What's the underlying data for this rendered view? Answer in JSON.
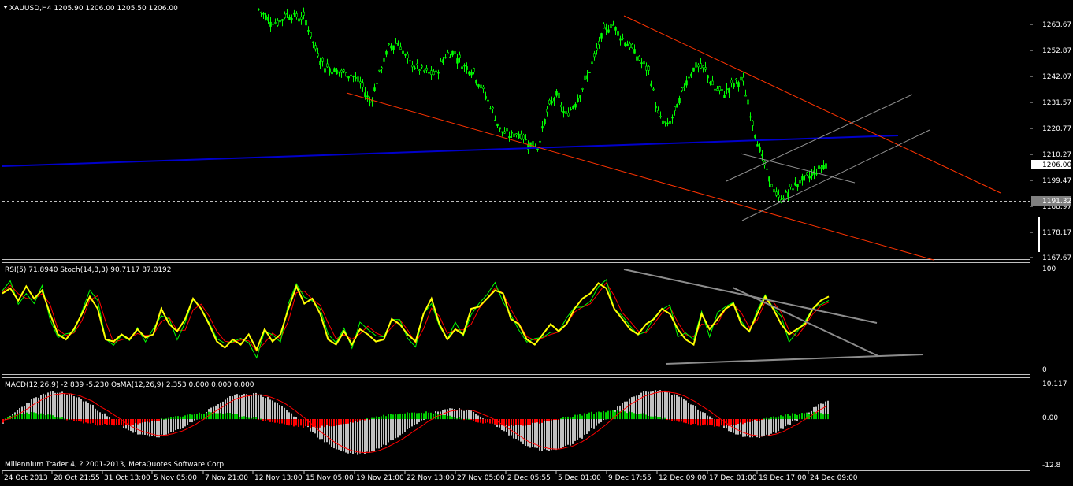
{
  "window": {
    "symbol_header": "XAUUSD,H4  1205.90 1206.00 1205.50 1206.00",
    "copyright": "Millennium Trader 4, ? 2001-2013, MetaQuotes Software Corp."
  },
  "colors": {
    "background": "#000000",
    "frame": "#c0c0c0",
    "bull_candle": "#00ff00",
    "bear_candle": "#00ff00",
    "red_channel": "#ff3300",
    "blue_trendline": "#0000cc",
    "gray_channel": "#909090",
    "rsi_line": "#ffff00",
    "stoch_main": "#00ff00",
    "stoch_signal": "#ff0000",
    "macd_pos": "#00cc00",
    "macd_neg": "#ff0000",
    "macd_hist": "#c0c0c0",
    "macd_signal": "#ff0000"
  },
  "chart_data": [
    {
      "type": "candlestick",
      "symbol": "XAUUSD",
      "timeframe": "H4",
      "ohlc_last": {
        "open": 1205.9,
        "high": 1206.0,
        "low": 1205.5,
        "close": 1206.0
      },
      "ylim": [
        1165,
        1275
      ],
      "y_ticks": [
        "1263.67",
        "1252.87",
        "1242.07",
        "1231.57",
        "1220.77",
        "1210.27",
        "1199.47",
        "1188.97",
        "1178.17",
        "1167.67"
      ],
      "current_price_label": "1206.00",
      "dashed_level_label": "1191.32",
      "dashed_level": 1191.32,
      "x_labels": [
        "24 Oct 2013",
        "28 Oct 21:55",
        "31 Oct 13:00",
        "5 Nov 05:00",
        "7 Nov 21:00",
        "12 Nov 13:00",
        "15 Nov 05:00",
        "19 Nov 21:00",
        "22 Nov 13:00",
        "27 Nov 05:00",
        "2 Dec 05:55",
        "5 Dec 01:00",
        "9 Dec 17:55",
        "12 Dec 09:00",
        "17 Dec 01:00",
        "19 Dec 17:00",
        "24 Dec 09:00"
      ],
      "close_path": [
        1272,
        1268,
        1266,
        1270,
        1269,
        1268,
        1256,
        1248,
        1246,
        1245,
        1244,
        1240,
        1232,
        1245,
        1256,
        1258,
        1250,
        1247,
        1245,
        1244,
        1252,
        1254,
        1248,
        1246,
        1238,
        1230,
        1220,
        1218,
        1219,
        1215,
        1213,
        1228,
        1236,
        1226,
        1232,
        1240,
        1250,
        1262,
        1266,
        1260,
        1256,
        1250,
        1245,
        1226,
        1222,
        1230,
        1242,
        1248,
        1246,
        1238,
        1236,
        1240,
        1242,
        1225,
        1210,
        1198,
        1190,
        1194,
        1198,
        1200,
        1203,
        1206
      ],
      "close_path_range": [
        0,
        1055
      ]
    },
    {
      "type": "line",
      "title": "RSI(5) 71.8940  Stoch(14,3,3) 90.7117 87.0192",
      "ylim": [
        0,
        100
      ],
      "y_ticks": [
        "100",
        "0"
      ],
      "series": [
        {
          "name": "RSI(5)",
          "last": 71.894,
          "values": [
            75,
            80,
            68,
            82,
            70,
            78,
            55,
            35,
            30,
            40,
            55,
            72,
            60,
            30,
            28,
            35,
            30,
            40,
            32,
            35,
            60,
            45,
            38,
            50,
            70,
            60,
            45,
            28,
            22,
            30,
            25,
            35,
            20,
            40,
            28,
            35,
            60,
            82,
            65,
            70,
            55,
            30,
            25,
            38,
            25,
            40,
            35,
            28,
            30,
            50,
            45,
            35,
            28,
            55,
            70,
            45,
            30,
            40,
            35,
            60,
            62,
            70,
            78,
            75,
            50,
            45,
            30,
            25,
            35,
            45,
            38,
            45,
            60,
            70,
            75,
            85,
            80,
            60,
            50,
            40,
            35,
            45,
            50,
            60,
            55,
            40,
            30,
            25,
            55,
            40,
            50,
            60,
            65,
            45,
            38,
            55,
            72,
            60,
            45,
            35,
            40,
            45,
            60,
            68,
            72
          ]
        },
        {
          "name": "Stoch main",
          "last": 90.7117
        },
        {
          "name": "Stoch signal",
          "last": 87.0192
        }
      ]
    },
    {
      "type": "bar",
      "title": "MACD(12,26,9) -2.839 -5.230  OsMA(12,26,9) 2.353 0.000 0.000 0.000",
      "ylim": [
        -12.8,
        10.117
      ],
      "y_ticks": [
        "10.117",
        "0.00",
        "-12.8"
      ],
      "macd_last": -2.839,
      "signal_last": -5.23,
      "osma_last": 2.353
    }
  ]
}
